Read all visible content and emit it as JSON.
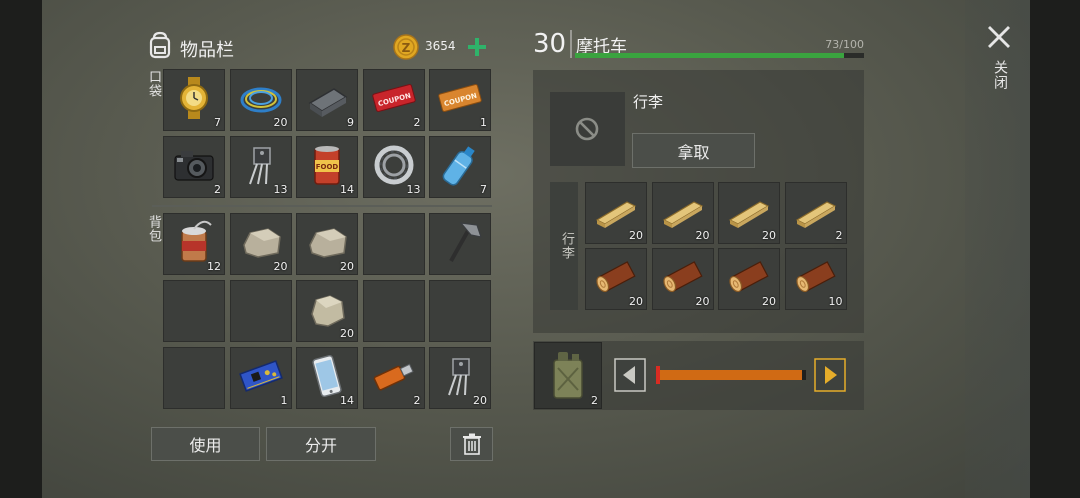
{
  "inventory": {
    "title": "物品栏",
    "coins": "3654",
    "pocket_label": "口袋",
    "backpack_label": "背包",
    "use_label": "使用",
    "split_label": "分开",
    "pocket_slots": [
      {
        "icon": "wristwatch-icon",
        "count": "7"
      },
      {
        "icon": "wire-coil-icon",
        "count": "20"
      },
      {
        "icon": "metal-ingot-icon",
        "count": "9"
      },
      {
        "icon": "red-coupon-icon",
        "count": "2"
      },
      {
        "icon": "orange-coupon-icon",
        "count": "1"
      },
      {
        "icon": "camera-icon",
        "count": "2"
      },
      {
        "icon": "transistor-icon",
        "count": "13"
      },
      {
        "icon": "food-can-icon",
        "count": "14"
      },
      {
        "icon": "bearing-icon",
        "count": "13"
      },
      {
        "icon": "water-bottle-icon",
        "count": "7"
      }
    ],
    "backpack_slots": [
      {
        "icon": "open-can-icon",
        "count": "12"
      },
      {
        "icon": "stone-icon",
        "count": "20"
      },
      {
        "icon": "stone-icon",
        "count": "20"
      },
      {
        "icon": "",
        "count": ""
      },
      {
        "icon": "hatchet-icon",
        "count": ""
      },
      {
        "icon": "",
        "count": ""
      },
      {
        "icon": "",
        "count": ""
      },
      {
        "icon": "rock-icon",
        "count": "20"
      },
      {
        "icon": "",
        "count": ""
      },
      {
        "icon": "",
        "count": ""
      },
      {
        "icon": "",
        "count": ""
      },
      {
        "icon": "circuit-board-icon",
        "count": "1"
      },
      {
        "icon": "smartphone-icon",
        "count": "14"
      },
      {
        "icon": "usb-drive-icon",
        "count": "2"
      },
      {
        "icon": "transistor-icon",
        "count": "20"
      }
    ]
  },
  "vehicle": {
    "level": "30",
    "name": "摩托车",
    "hp_text": "73/100",
    "hp_fraction": 0.93,
    "trunk_title": "行李",
    "take_label": "拿取",
    "storage_label": "行李",
    "storage_slots": [
      {
        "icon": "plank-icon",
        "count": "20"
      },
      {
        "icon": "plank-icon",
        "count": "20"
      },
      {
        "icon": "plank-icon",
        "count": "20"
      },
      {
        "icon": "plank-icon",
        "count": "2"
      },
      {
        "icon": "log-icon",
        "count": "20"
      },
      {
        "icon": "log-icon",
        "count": "20"
      },
      {
        "icon": "log-icon",
        "count": "20"
      },
      {
        "icon": "log-icon",
        "count": "10"
      }
    ],
    "fuel_count": "2",
    "fuel_fraction": 0.97
  },
  "close_label": "关闭",
  "colors": {
    "hp_green": "#3aa33f",
    "coin_gold": "#e0a722",
    "plus_green": "#2fb36a",
    "fuel_orange": "#d06a14",
    "arrow_gold": "#e6ad2a"
  }
}
